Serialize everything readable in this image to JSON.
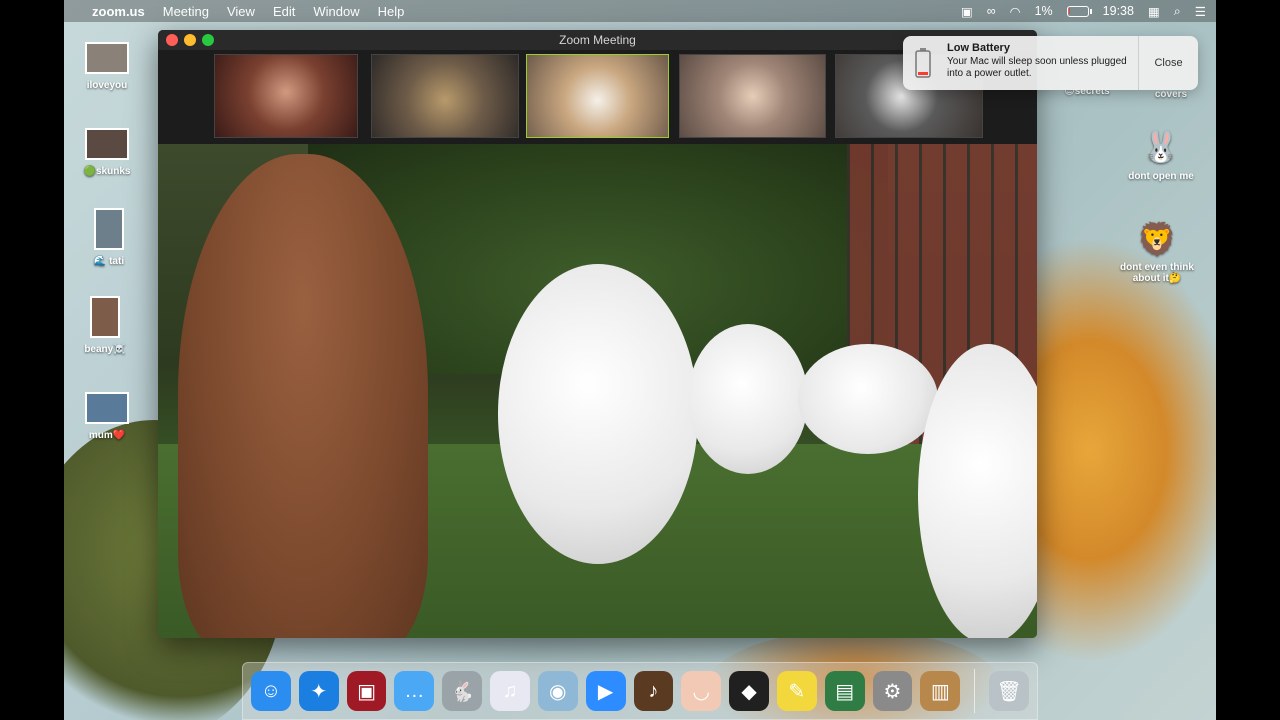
{
  "menubar": {
    "app_name": "zoom.us",
    "menus": [
      "Meeting",
      "View",
      "Edit",
      "Window",
      "Help"
    ],
    "battery_percent": "1%",
    "battery_level": 0.01,
    "time": "19:38"
  },
  "desktop_icons": [
    {
      "label": "iloveyou"
    },
    {
      "label": "🟢skunks"
    },
    {
      "label": "🌊 tati"
    },
    {
      "label": "beany☠️"
    },
    {
      "label": "mum❤️"
    },
    {
      "label": "😌secrets"
    },
    {
      "label": "covers"
    },
    {
      "label": "dont open me"
    },
    {
      "label": "dont even think about it🤔"
    }
  ],
  "zoom_window": {
    "title": "Zoom Meeting",
    "participants": 5
  },
  "notification": {
    "title": "Low Battery",
    "message": "Your Mac will sleep soon unless plugged into a power outlet.",
    "close_label": "Close"
  },
  "dock": {
    "apps": [
      {
        "name": "finder",
        "glyph": "☺",
        "color": "#2b8df0"
      },
      {
        "name": "safari",
        "glyph": "✦",
        "color": "#1a7fe0"
      },
      {
        "name": "photo-booth",
        "glyph": "▣",
        "color": "#a01a26"
      },
      {
        "name": "messages",
        "glyph": "…",
        "color": "#4aa8f5"
      },
      {
        "name": "rabbit",
        "glyph": "🐇",
        "color": "#9aa3a8"
      },
      {
        "name": "itunes",
        "glyph": "♫",
        "color": "#e8e8f2"
      },
      {
        "name": "seal",
        "glyph": "◉",
        "color": "#8fb7d6"
      },
      {
        "name": "zoom",
        "glyph": "▶",
        "color": "#2d8cff"
      },
      {
        "name": "garageband",
        "glyph": "♪",
        "color": "#5a3a20"
      },
      {
        "name": "face",
        "glyph": "◡",
        "color": "#f1c9b5"
      },
      {
        "name": "photo-app",
        "glyph": "◆",
        "color": "#202020"
      },
      {
        "name": "stickies",
        "glyph": "✎",
        "color": "#f2d83c"
      },
      {
        "name": "preview",
        "glyph": "▤",
        "color": "#2f7c44"
      },
      {
        "name": "system-preferences",
        "glyph": "⚙",
        "color": "#8a8a8a"
      },
      {
        "name": "notes",
        "glyph": "▥",
        "color": "#b8874c"
      }
    ],
    "trash": {
      "name": "trash",
      "glyph": "🗑",
      "color": "#b9c3c7"
    }
  }
}
